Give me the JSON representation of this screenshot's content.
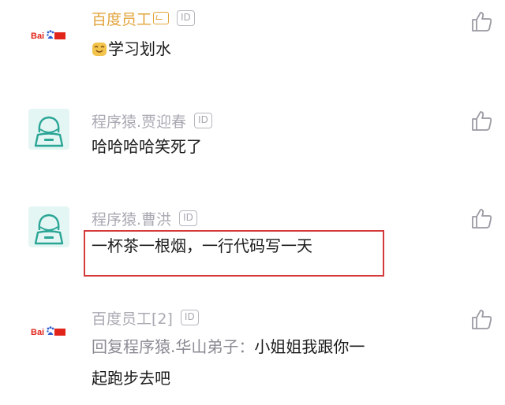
{
  "comments": [
    {
      "username": "百度员工",
      "id_badge": "ID",
      "text": "学习划水",
      "emoji": "smiling-face-emoji",
      "avatar": "baidu-logo"
    },
    {
      "username": "程序猿.贾迎春",
      "id_badge": "ID",
      "text": "哈哈哈哈笑死了",
      "avatar": "coder-avatar"
    },
    {
      "username": "程序猿.曹洪",
      "id_badge": "ID",
      "text": "一杯茶一根烟，一行代码写一天",
      "avatar": "coder-avatar",
      "highlighted": true
    },
    {
      "username": "百度员工[2]",
      "id_badge": "ID",
      "reply_prefix": "回复程序猿.华山弟子：",
      "text_line1": "小姐姐我跟你一",
      "text_line2": "起跑步去吧",
      "avatar": "baidu-logo"
    }
  ],
  "icons": {
    "like": "thumbs-up-icon",
    "vip": "vip-badge-icon"
  },
  "colors": {
    "highlight_border": "#d43a3a",
    "gold_name": "#e2a33a",
    "muted": "#a9a9b3",
    "avatar_bg": "#e4f6f3",
    "coder_outline": "#2aa596"
  }
}
